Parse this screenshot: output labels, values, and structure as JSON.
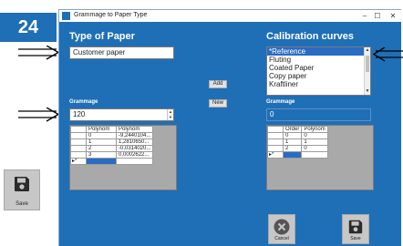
{
  "step_number": "24",
  "external_save": {
    "label": "Save",
    "icon": "floppy-disk-icon"
  },
  "window": {
    "title": "Grammage to Paper Type",
    "controls": {
      "minimize": "–",
      "maximize": "☐",
      "close": "✕"
    }
  },
  "left": {
    "heading": "Type of Paper",
    "paper_value": "Customer paper",
    "grammage_label": "Grammage",
    "grammage_value": "120",
    "grid": {
      "columns": [
        "Polynom",
        "Polynom"
      ],
      "rows": [
        {
          "order": "0",
          "value": "-9,2440104..."
        },
        {
          "order": "1",
          "value": "1,2810650..."
        },
        {
          "order": "2",
          "value": "-0,0314020..."
        },
        {
          "order": "3",
          "value": "0,0002622..."
        }
      ],
      "new_row_marker": "▸*"
    }
  },
  "middle": {
    "add_label": "Add",
    "new_label": "New"
  },
  "right": {
    "heading": "Calibration curves",
    "curves": [
      "*Reference",
      "Fluting",
      "Coated Paper",
      "Copy paper",
      "Kraftliner"
    ],
    "selected_curve": "*Reference",
    "grammage_label": "Grammage",
    "grammage_value": "0",
    "grid": {
      "columns": [
        "Order",
        "Polynom"
      ],
      "rows": [
        {
          "order": "0",
          "value": "0"
        },
        {
          "order": "1",
          "value": "1"
        },
        {
          "order": "2",
          "value": "0"
        }
      ],
      "new_row_marker": "▸*"
    }
  },
  "footer": {
    "cancel_label": "Cancel",
    "save_label": "Save"
  },
  "colors": {
    "window_blue": "#1f6fb6",
    "selection_blue": "#2a6bc3"
  }
}
